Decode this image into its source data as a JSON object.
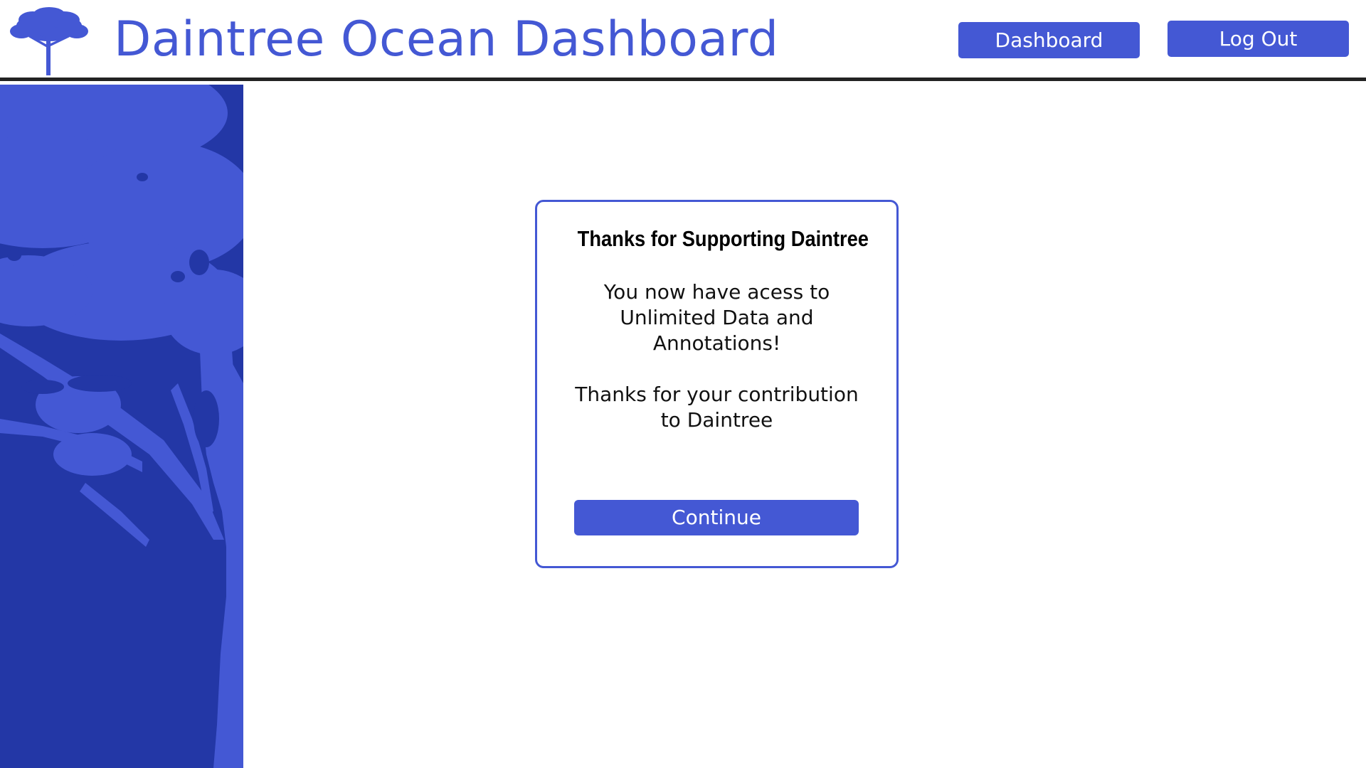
{
  "header": {
    "title": "Daintree Ocean Dashboard",
    "logo_icon": "tree-icon",
    "nav": {
      "dashboard_label": "Dashboard",
      "logout_label": "Log Out"
    }
  },
  "sidebar": {
    "decoration_icon": "tree-silhouette-icon"
  },
  "dialog": {
    "title": "Thanks for Supporting Daintree",
    "message_line1": "You now have acess to Unlimited Data and Annotations!",
    "message_line2": "Thanks for your contribution to Daintree",
    "continue_label": "Continue"
  },
  "colors": {
    "accent": "#4458d4",
    "sidebar_bg": "#2337a6",
    "header_rule": "#222222"
  }
}
